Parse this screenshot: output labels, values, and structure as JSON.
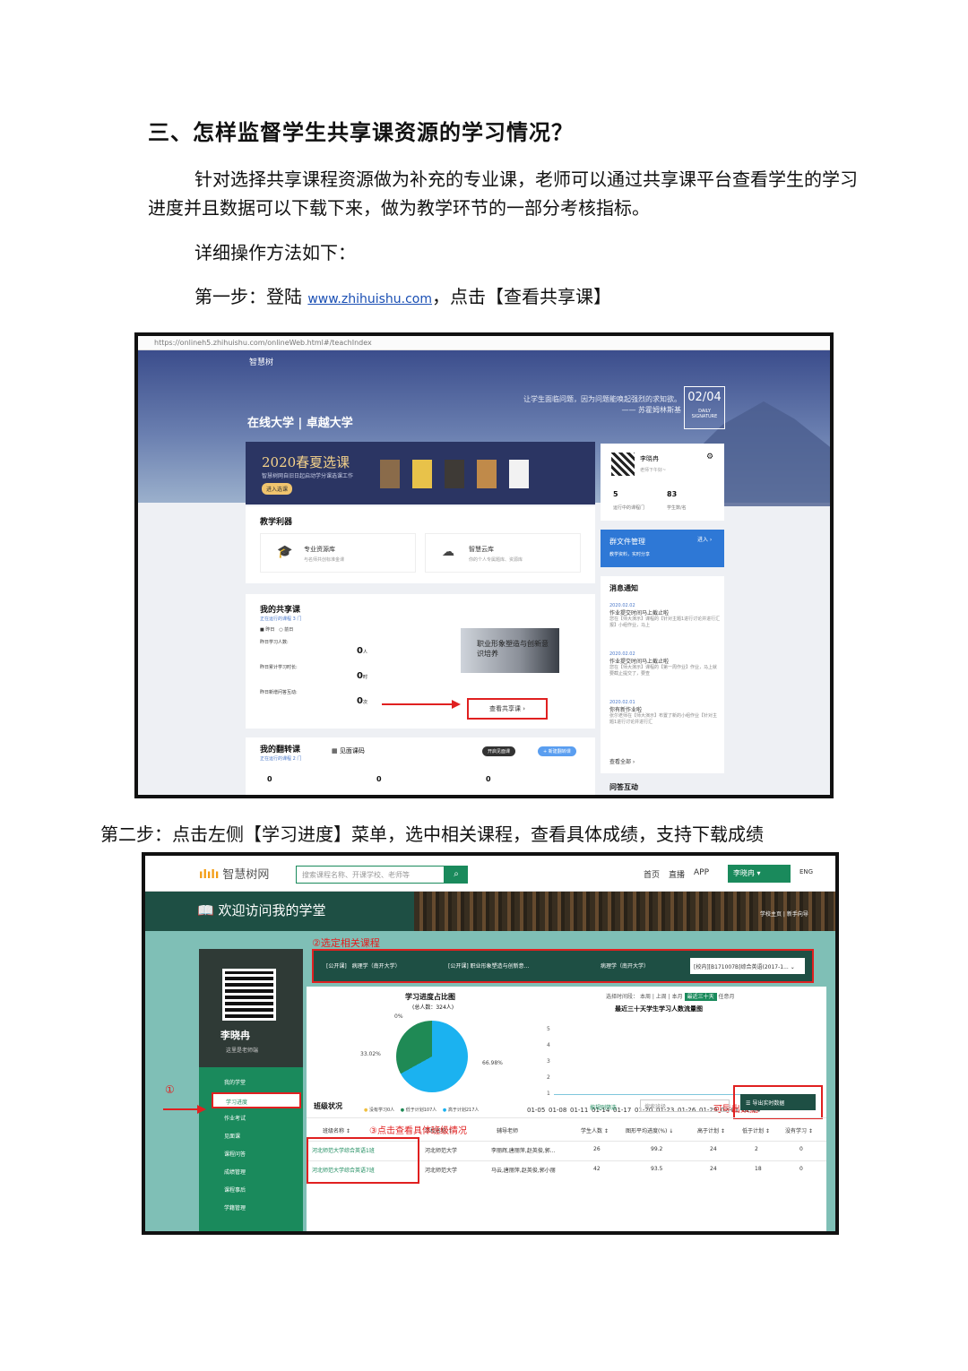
{
  "doc": {
    "heading": "三、怎样监督学生共享课资源的学习情况？",
    "para1": "针对选择共享课程资源做为补充的专业课，老师可以通过共享课平台查看学生的学习进度并且数据可以下载下来，做为教学环节的一部分考核指标。",
    "para2": "详细操作方法如下：",
    "step1_prefix": "第一步：登陆",
    "step1_link": "www.zhihuishu.com",
    "step1_suffix": "，点击【查看共享课】",
    "step2": "第二步：点击左侧【学习进度】菜单，选中相关课程，查看具体成绩，支持下载成绩"
  },
  "shot1": {
    "url": "https://onlineh5.zhihuishu.com/onlineWeb.html#/teachIndex",
    "logo": "智慧树",
    "brand": "在线大学 | 卓越大学",
    "quote_line1": "让学生面临问题，因为问题能唤起强烈的求知欲。",
    "quote_line2": "—— 苏霍姆林斯基",
    "date": "02/04",
    "date_sub": "DAILY SIGNATURE",
    "banner_title": "2020春夏选课",
    "banner_sub": "智慧树网自旧日起启动学分课选课工作",
    "banner_btn": "进入选课",
    "tools_label": "教学利器",
    "tool1": "专业资源库",
    "tool1_sub": "与名师共创标准金课",
    "tool2": "智慧云库",
    "tool2_sub": "你的个人专属题库、资源库",
    "share_label": "我的共享课",
    "share_sub": "正在运行的课程 3 门",
    "tab_today": "昨日",
    "tab_prev": "前日",
    "row1": "昨日学习人数:",
    "row2": "昨日累计学习时长:",
    "row3": "昨日新增问答互动:",
    "val1": "0",
    "val2": "0",
    "val3": "0",
    "unit1": "人",
    "unit2": "时",
    "unit3": "次",
    "img_text": "职业形象塑造与创新意识培养",
    "view_btn": "查看共享课 ›",
    "flip_label": "我的翻转课",
    "flip_sub": "正在运行的课程 2 门",
    "flip_code": "见面课码",
    "flip_b1": "开启见面课",
    "flip_b2": "+ 新建翻转课",
    "flip_zero": "0",
    "user": "李晓冉",
    "greet": "老师下午好~",
    "n1": "5",
    "n2": "83",
    "l1": "运行中的课程门",
    "l2": "学生数/名",
    "group_title": "群文件管理",
    "group_sub": "教学资料，实时分享",
    "group_enter": "进入 ›",
    "msg_title": "消息通知",
    "msgs": [
      {
        "date": "2020.02.02",
        "title": "作业提交时间马上截止啦",
        "body": "您在【师大演示】课程的【针对主题1进行讨论并进行汇报】小组作业，马上"
      },
      {
        "date": "2020.02.02",
        "title": "作业提交时间马上截止啦",
        "body": "您在【师大演示】课程的【第一周作业】作业，马上就要截止提交了，要查"
      },
      {
        "date": "2020.02.01",
        "title": "你有新作业啦",
        "body": "张尔老师在【师大演示】布置了新的小组作业【针对主题1进行讨论并进行汇"
      }
    ],
    "msg_more": "查看全部 ›",
    "qa": "问答互动"
  },
  "shot2": {
    "logo": "智慧树网",
    "search_ph": "搜索课程名称、开课学校、老师等",
    "nav": [
      "首页",
      "直播",
      "APP"
    ],
    "user": "李晓冉",
    "eng": "ENG",
    "title": "欢迎访问我的学堂",
    "links": "学校主页 | 新手向导",
    "note2": "②选定相关课程",
    "courses": [
      "[公开课]　病理学（南开大学）",
      "[公开课] 职业形象塑造与创新意...",
      "病理学（南开大学）"
    ],
    "select": "[校内][B171007B]综合英语(2017-1...",
    "name": "李晓冉",
    "role": "这里是老师端",
    "menu": [
      "我的学堂",
      "学习进度",
      "作业考试",
      "见面课",
      "课程问答",
      "成绩管理",
      "课程事后",
      "学籍管理"
    ],
    "circle1": "①",
    "pie_title": "学习进度占比图",
    "pie_total": "(总人数：324人)",
    "pie_labels": [
      "0%",
      "33.02%",
      "66.98%"
    ],
    "legend": [
      "没有学习0人",
      "低于计划107人",
      "高于计划217人"
    ],
    "range_label": "选择时间段：",
    "ranges": [
      "本周",
      "上周",
      "本月",
      "最近三十天",
      "任意月"
    ],
    "line_title": "最近三十天学生学习人数流量图",
    "yticks": [
      "5",
      "4",
      "3",
      "2",
      "1"
    ],
    "xticks": [
      "01-05",
      "01-08",
      "01-11",
      "01-14",
      "01-17",
      "01-20",
      "01-23",
      "01-26",
      "01-29",
      "02-01",
      "02-04"
    ],
    "export_note": "可导出数据",
    "export_btn": "导出实时数据",
    "cls_label": "班级状况",
    "filter": "按规则筛选",
    "filter_ph": "搜索班级",
    "note3": "③点击查看具体班级情况",
    "headers": [
      "班级名称 ↕",
      "学校名称 ↕",
      "辅导老师",
      "学生人数 ↕",
      "图形平均进度(%) ↓",
      "高于计划 ↕",
      "低于计划 ↕",
      "没有学习 ↕"
    ],
    "rows": [
      [
        "河北师范大学综合英语1班",
        "河北师范大学",
        "李丽辉,唐丽萍,赵英俊,郭...",
        "26",
        "99.2",
        "24",
        "2",
        "0"
      ],
      [
        "河北师范大学综合英语7班",
        "河北师范大学",
        "马云,唐丽萍,赵英俊,郭小丽",
        "42",
        "93.5",
        "24",
        "18",
        "0"
      ]
    ]
  }
}
